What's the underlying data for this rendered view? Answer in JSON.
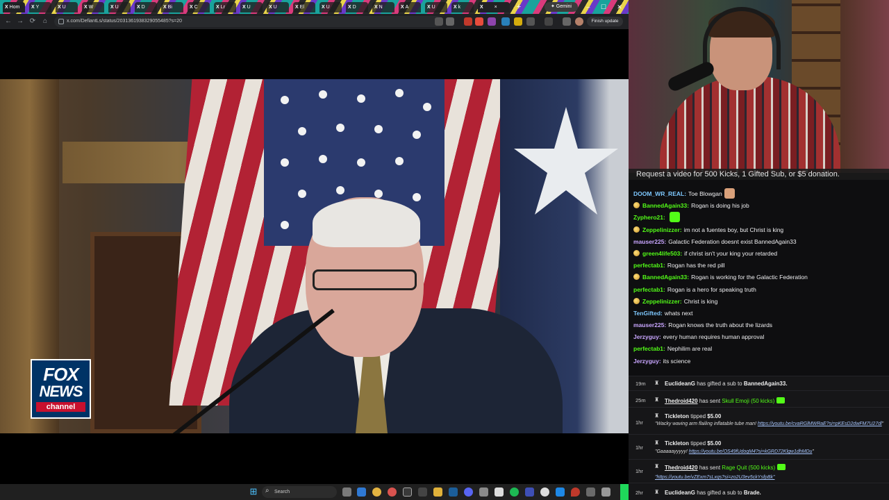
{
  "browser": {
    "tabs": [
      {
        "label": "Hom"
      },
      {
        "label": "Y"
      },
      {
        "label": "U"
      },
      {
        "label": "W"
      },
      {
        "label": "U"
      },
      {
        "label": "D"
      },
      {
        "label": "Bi"
      },
      {
        "label": "C"
      },
      {
        "label": "Lr"
      },
      {
        "label": "U"
      },
      {
        "label": "U"
      },
      {
        "label": "El"
      },
      {
        "label": "U"
      },
      {
        "label": "D"
      },
      {
        "label": "N"
      },
      {
        "label": "A"
      },
      {
        "label": "U"
      },
      {
        "label": "k"
      },
      {
        "label": "×"
      }
    ],
    "new_tab": "+",
    "gemini_label": "✦ Gemini",
    "url": "x.com/DefiantLs/status/2031361938329055485?s=20",
    "finish_update": "Finish update",
    "window_controls": {
      "minimize": "–",
      "maximize": "☐",
      "close": "✕"
    },
    "nav": {
      "back": "←",
      "forward": "→",
      "reload": "⟳",
      "home": "⌂"
    }
  },
  "video": {
    "network_logo": {
      "fox": "FOX",
      "news": "NEWS",
      "channel": "channel"
    }
  },
  "taskbar": {
    "start_icon": "⊞",
    "search_placeholder": "Search",
    "search_icon": "⌕",
    "apps": [
      "file-explorer-icon",
      "edge-icon",
      "chrome-icon",
      "chrome-icon",
      "obs-icon",
      "terminal-icon",
      "folder-icon",
      "steam-icon",
      "discord-icon",
      "reaper-icon",
      "vscode-icon",
      "spotify-icon",
      "notion-icon",
      "github-icon",
      "browser-icon",
      "maps-icon",
      "snipping-icon",
      "settings-icon"
    ]
  },
  "stream": {
    "request_text": "Request a video for 500 Kicks, 1 Gifted Sub, or $5 donation."
  },
  "chat": {
    "messages": [
      {
        "user": "DOOM_WR_REAL:",
        "text": "Toe Blowgan",
        "color": "#7ec8ff",
        "badge": false,
        "emote": "#d9a07a"
      },
      {
        "user": "BannedAgain33:",
        "text": "Rogan is doing his job",
        "color": "#53fc18",
        "badge": true,
        "emote": ""
      },
      {
        "user": "Zyphero21:",
        "text": "",
        "color": "#53fc18",
        "badge": false,
        "emote": "#53fc18"
      },
      {
        "user": "Zeppelinizzer:",
        "text": "im not a fuentes boy, but Christ is king",
        "color": "#53fc18",
        "badge": true,
        "emote": ""
      },
      {
        "user": "mauser225:",
        "text": "Galactic Federation doesnt exist BannedAgain33",
        "color": "#c9a6ff",
        "badge": false,
        "emote": ""
      },
      {
        "user": "green4life503:",
        "text": "if christ isn't your king your retarded",
        "color": "#53fc18",
        "badge": true,
        "emote": ""
      },
      {
        "user": "perfectab1:",
        "text": "Rogan has the red pill",
        "color": "#53fc18",
        "badge": false,
        "emote": ""
      },
      {
        "user": "BannedAgain33:",
        "text": "Rogan is working for the Galactic Federation",
        "color": "#53fc18",
        "badge": true,
        "emote": ""
      },
      {
        "user": "perfectab1:",
        "text": "Rogan is a hero for speaking truth",
        "color": "#53fc18",
        "badge": false,
        "emote": ""
      },
      {
        "user": "Zeppelinizzer:",
        "text": "Christ is king",
        "color": "#53fc18",
        "badge": true,
        "emote": ""
      },
      {
        "user": "TenGifted:",
        "text": "whats next",
        "color": "#7ec8ff",
        "badge": false,
        "emote": ""
      },
      {
        "user": "mauser225:",
        "text": "Rogan knows the truth about the lizards",
        "color": "#c9a6ff",
        "badge": false,
        "emote": ""
      },
      {
        "user": "Jerzyguy:",
        "text": "every human requires human approval",
        "color": "#c9a6ff",
        "badge": false,
        "emote": ""
      },
      {
        "user": "perfectab1:",
        "text": "Nephilim are real",
        "color": "#53fc18",
        "badge": false,
        "emote": ""
      },
      {
        "user": "Jerzyguy:",
        "text": "its science",
        "color": "#c9a6ff",
        "badge": false,
        "emote": ""
      }
    ]
  },
  "events": {
    "e1": {
      "time": "19m",
      "user": "EuclideanG",
      "text": "has gifted a sub to",
      "target": "BannedAgain33."
    },
    "e2": {
      "time": "25m",
      "user": "Thedroid420",
      "text": "has sent",
      "item": "Skull Emoji (50 kicks)"
    },
    "e3": {
      "time": "1hr",
      "user": "Tickleton",
      "text": "tipped",
      "amount": "$5.00",
      "msg": "\"Wacky waving arm flailing inflatable tube man!",
      "link": "https://youtu.be/cvaRGlMWRaE?si=pKEsD2dwFM7U27dl",
      "end": "\""
    },
    "e4": {
      "time": "1hr",
      "user": "Tickleton",
      "text": "tipped",
      "amount": "$5.00",
      "msg": "\"Gaaaaayyyyy!",
      "link": "https://youtu.be/OS49fUdoqM4?si=kGRD72Klgw1dhMDu",
      "end": "\""
    },
    "e5": {
      "time": "1hr",
      "user": "Thedroid420",
      "text": "has sent",
      "item": "Rage Quit (500 kicks)",
      "link": "\"https://youtu.be/vZExm7sLxqs?si=zo2U3ev5ckYsfpBk\""
    },
    "e6": {
      "time": "2hr",
      "user": "EuclideanG",
      "text": "has gifted a sub to",
      "target": "Brade."
    },
    "icon": "♜"
  }
}
